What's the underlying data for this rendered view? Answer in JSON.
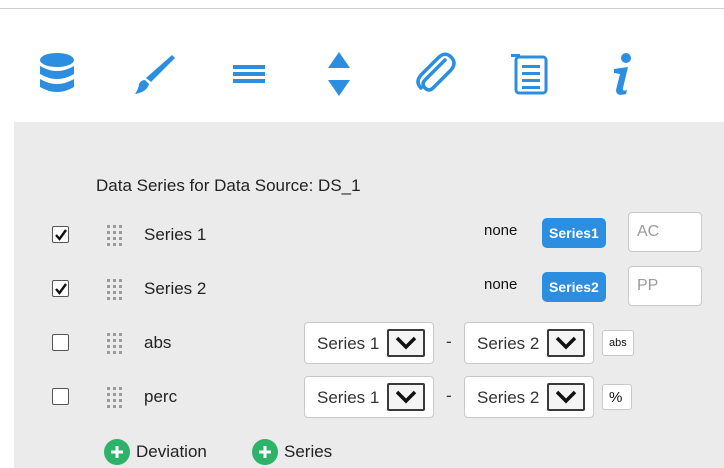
{
  "tabs": [
    {
      "icon": "database-icon",
      "active": true
    },
    {
      "icon": "brush-icon",
      "active": false
    },
    {
      "icon": "menu-lines-icon",
      "active": false
    },
    {
      "icon": "sort-arrows-icon",
      "active": false
    },
    {
      "icon": "paperclip-icon",
      "active": false
    },
    {
      "icon": "list-icon",
      "active": false
    },
    {
      "icon": "info-icon",
      "active": false
    }
  ],
  "section": {
    "title_strong": "Data Series",
    "title_rest": " for Data Source: DS_1"
  },
  "rows": [
    {
      "checked": true,
      "label": "Series 1",
      "none": "none",
      "badge": "Series1",
      "code": "AC"
    },
    {
      "checked": true,
      "label": "Series 2",
      "none": "none",
      "badge": "Series2",
      "code": "PP"
    },
    {
      "checked": false,
      "label": "abs",
      "select1": "Series 1",
      "dash": "-",
      "select2": "Series 2",
      "unit": "abs"
    },
    {
      "checked": false,
      "label": "perc",
      "select1": "Series 1",
      "dash": "-",
      "select2": "Series 2",
      "unit": "%"
    }
  ],
  "buttons": {
    "deviation": "Deviation",
    "series": "Series"
  },
  "colors": {
    "accent_blue": "#2b8ee0",
    "add_green": "#2db26a",
    "panel_bg": "#ebebeb"
  }
}
